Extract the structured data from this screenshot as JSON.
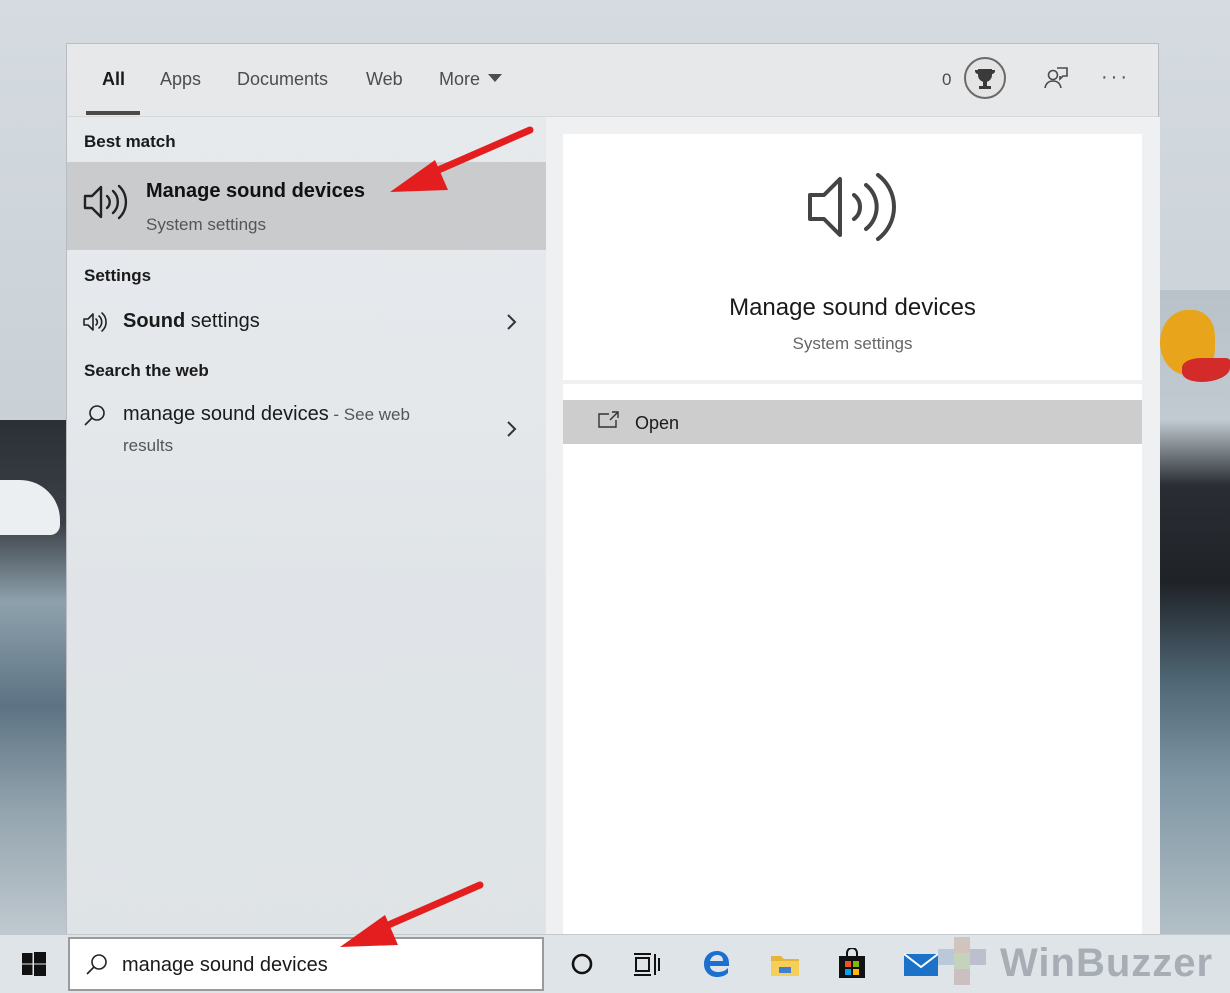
{
  "tabs": [
    {
      "label": "All",
      "active": true
    },
    {
      "label": "Apps"
    },
    {
      "label": "Documents"
    },
    {
      "label": "Web"
    },
    {
      "label": "More"
    }
  ],
  "header": {
    "points": "0"
  },
  "sections": {
    "best_match": "Best match",
    "settings": "Settings",
    "search_web": "Search the web"
  },
  "best_match_item": {
    "title": "Manage sound devices",
    "subtitle": "System settings",
    "icon": "speaker-icon"
  },
  "settings_item": {
    "bold": "Sound",
    "rest": " settings",
    "icon": "speaker-icon"
  },
  "web_item": {
    "query": "manage sound devices",
    "suffix_line1": " - See web",
    "suffix_line2": "results",
    "icon": "search-icon"
  },
  "preview": {
    "title": "Manage sound devices",
    "subtitle": "System settings"
  },
  "actions": [
    {
      "label": "Open",
      "icon": "open-icon"
    }
  ],
  "taskbar": {
    "search_value": "manage sound devices",
    "watermark": "WinBuzzer",
    "icons": [
      "windows-start-icon",
      "cortana-icon",
      "task-view-icon",
      "edge-icon",
      "file-explorer-icon",
      "store-icon",
      "mail-icon"
    ]
  },
  "colors": {
    "accent_arrow": "#e41e1e",
    "selected_row": "#c9cbcd",
    "open_row": "#cdcdcd"
  }
}
